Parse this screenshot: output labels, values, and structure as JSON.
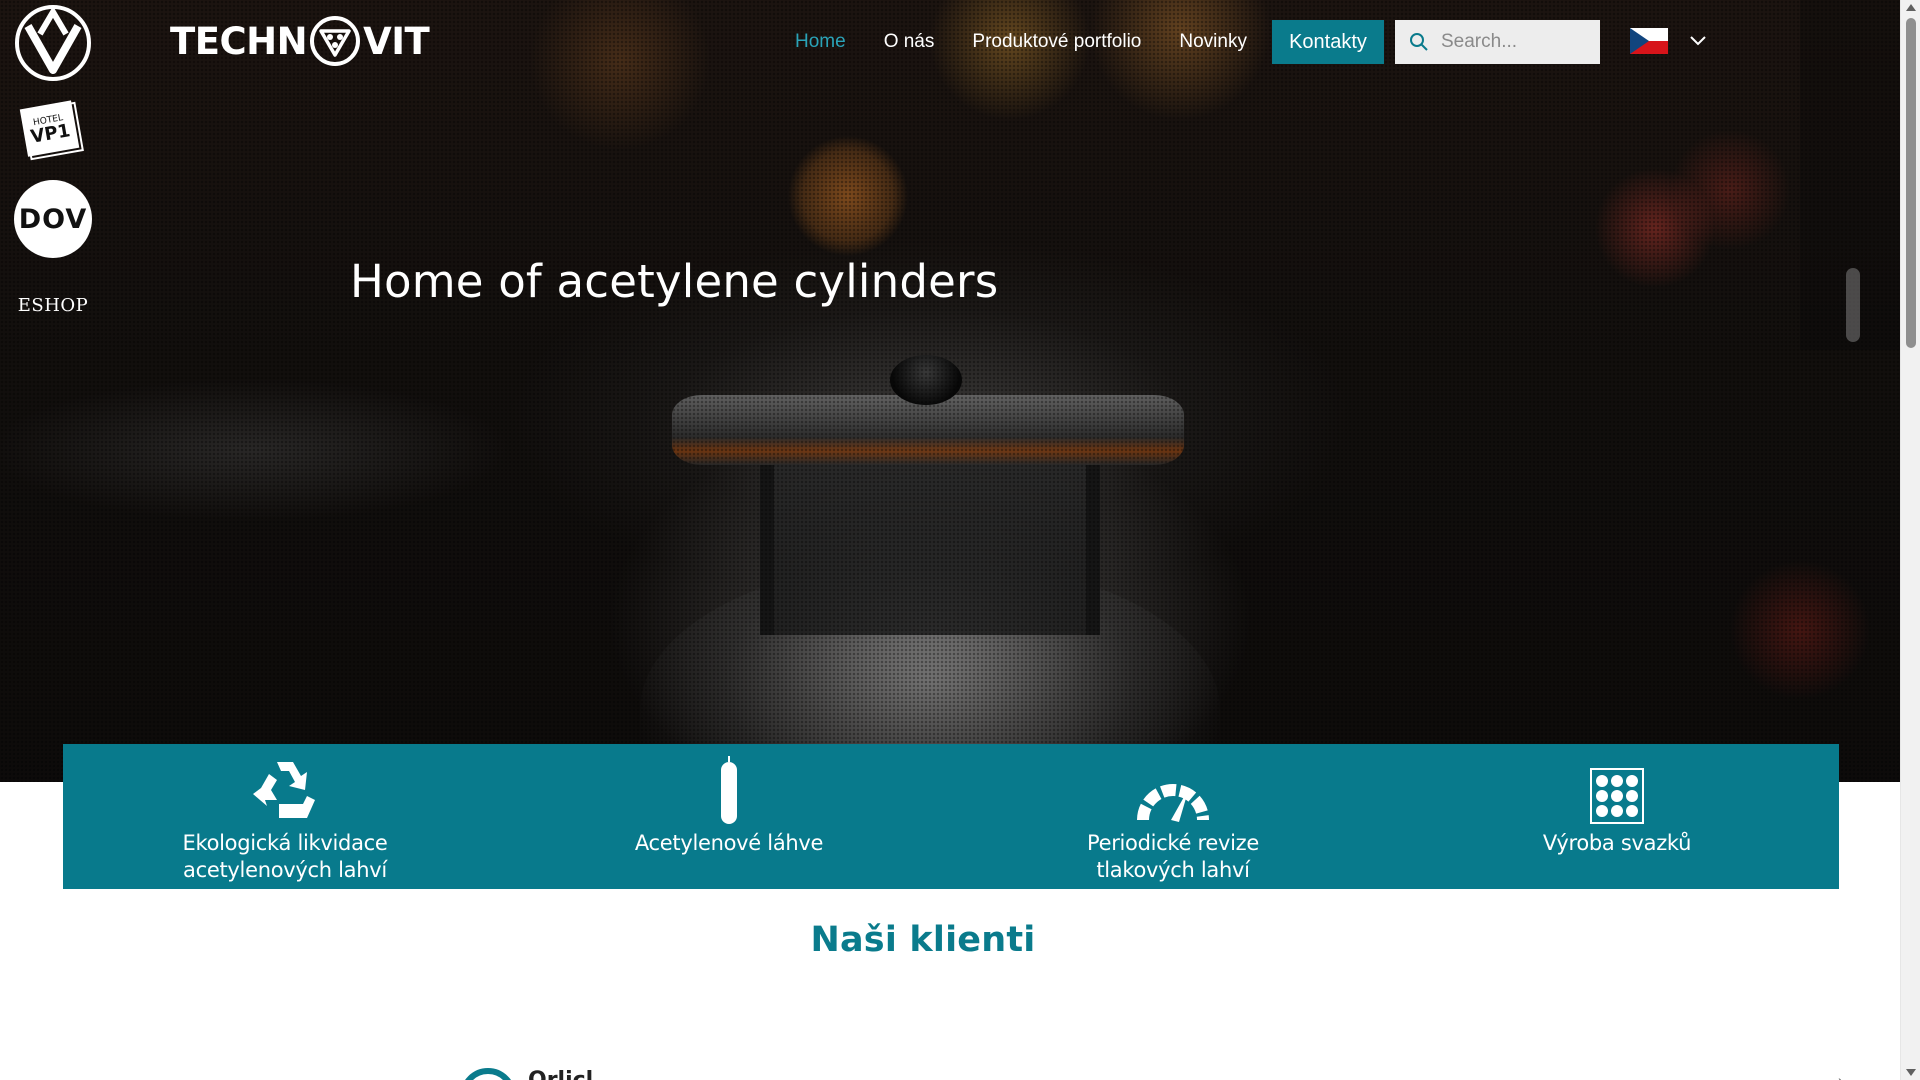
{
  "header": {
    "logo_left": "TECHN",
    "logo_right": "VIT",
    "nav": {
      "home": "Home",
      "about": "O nás",
      "portfolio": "Produktové portfolio",
      "news": "Novinky",
      "contacts": "Kontakty"
    },
    "search": {
      "placeholder": "Search..."
    },
    "language": {
      "selected": "CZ",
      "icon": "czech-flag-icon"
    }
  },
  "hero": {
    "title": "Home of acetylene cylinders"
  },
  "side_rail": {
    "items": [
      {
        "name": "partner-logo-av",
        "text": ""
      },
      {
        "name": "hotel-vp1-logo",
        "text": "HOTEL VP1"
      },
      {
        "name": "dov-logo",
        "text": "DOV"
      },
      {
        "name": "eshop-link",
        "text": "ESHOP"
      }
    ]
  },
  "features": [
    {
      "icon": "recycle-icon",
      "label_line1": "Ekologická likvidace",
      "label_line2": "acetylenových lahví"
    },
    {
      "icon": "cylinder-icon",
      "label_line1": "Acetylenové láhve",
      "label_line2": ""
    },
    {
      "icon": "gauge-icon",
      "label_line1": "Periodické revize",
      "label_line2": "tlakových lahví"
    },
    {
      "icon": "bundle-icon",
      "label_line1": "Výroba svazků",
      "label_line2": ""
    }
  ],
  "clients": {
    "title": "Naši klienti",
    "first_item_text": "Orlicl..."
  },
  "colors": {
    "teal": "#087a8c",
    "nav_active": "#2aa3b8"
  }
}
